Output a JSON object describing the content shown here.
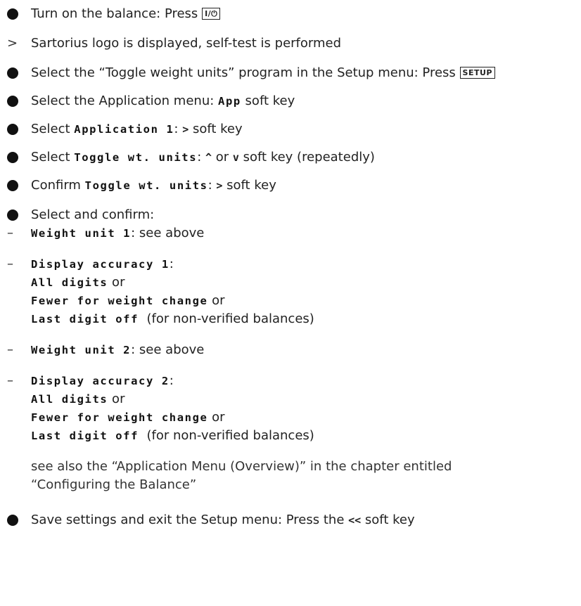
{
  "steps": {
    "s1": {
      "text": "Turn on the balance: Press",
      "key": "I/⏻"
    },
    "s2": {
      "text": "Sartorius logo is displayed, self-test is performed"
    },
    "s3": {
      "text": "Select the “Toggle weight units” program in the Setup menu:  Press",
      "key": "SETUP"
    },
    "s4": {
      "pre": "Select the Application menu: ",
      "lcd": "App",
      "post": " soft key"
    },
    "s5": {
      "pre": "Select ",
      "lcd": "Application 1",
      "mid": ": ",
      "glyph": ">",
      "post": " soft key"
    },
    "s6": {
      "pre": "Select ",
      "lcd": "Toggle wt. units",
      "mid": ": ",
      "glyph1": "^",
      "or": " or ",
      "glyph2": "v",
      "post": " soft key (repeatedly)"
    },
    "s7": {
      "pre": "Confirm ",
      "lcd": "Toggle wt. units",
      "mid": ": ",
      "glyph": ">",
      "post": " soft key"
    },
    "s8": {
      "text": "Select and confirm:"
    },
    "d1": {
      "lcd": "Weight unit 1",
      "post": ": see above"
    },
    "d2": {
      "lcd": "Display accuracy 1",
      "mid": ":",
      "opt1": "All digits",
      "or1": " or",
      "opt2": "Fewer for weight change",
      "or2": " or",
      "opt3": "Last digit off",
      "note": "(for non-verified balances)"
    },
    "d3": {
      "lcd": "Weight unit 2",
      "post": ": see above"
    },
    "d4": {
      "lcd": "Display accuracy 2",
      "mid": ":",
      "opt1": "All digits",
      "or1": " or",
      "opt2": "Fewer for weight change",
      "or2": " or",
      "opt3": "Last digit off",
      "note": "(for non-verified balances)"
    },
    "see1": "see also the “Application Menu (Overview)” in the chapter entitled",
    "see2": "“Configuring the Balance”",
    "s9": {
      "text": "Save settings and exit the Setup menu: Press the ",
      "glyph": "<<",
      "post": " soft key"
    }
  },
  "markers": {
    "gt": ">",
    "dash": "–"
  }
}
